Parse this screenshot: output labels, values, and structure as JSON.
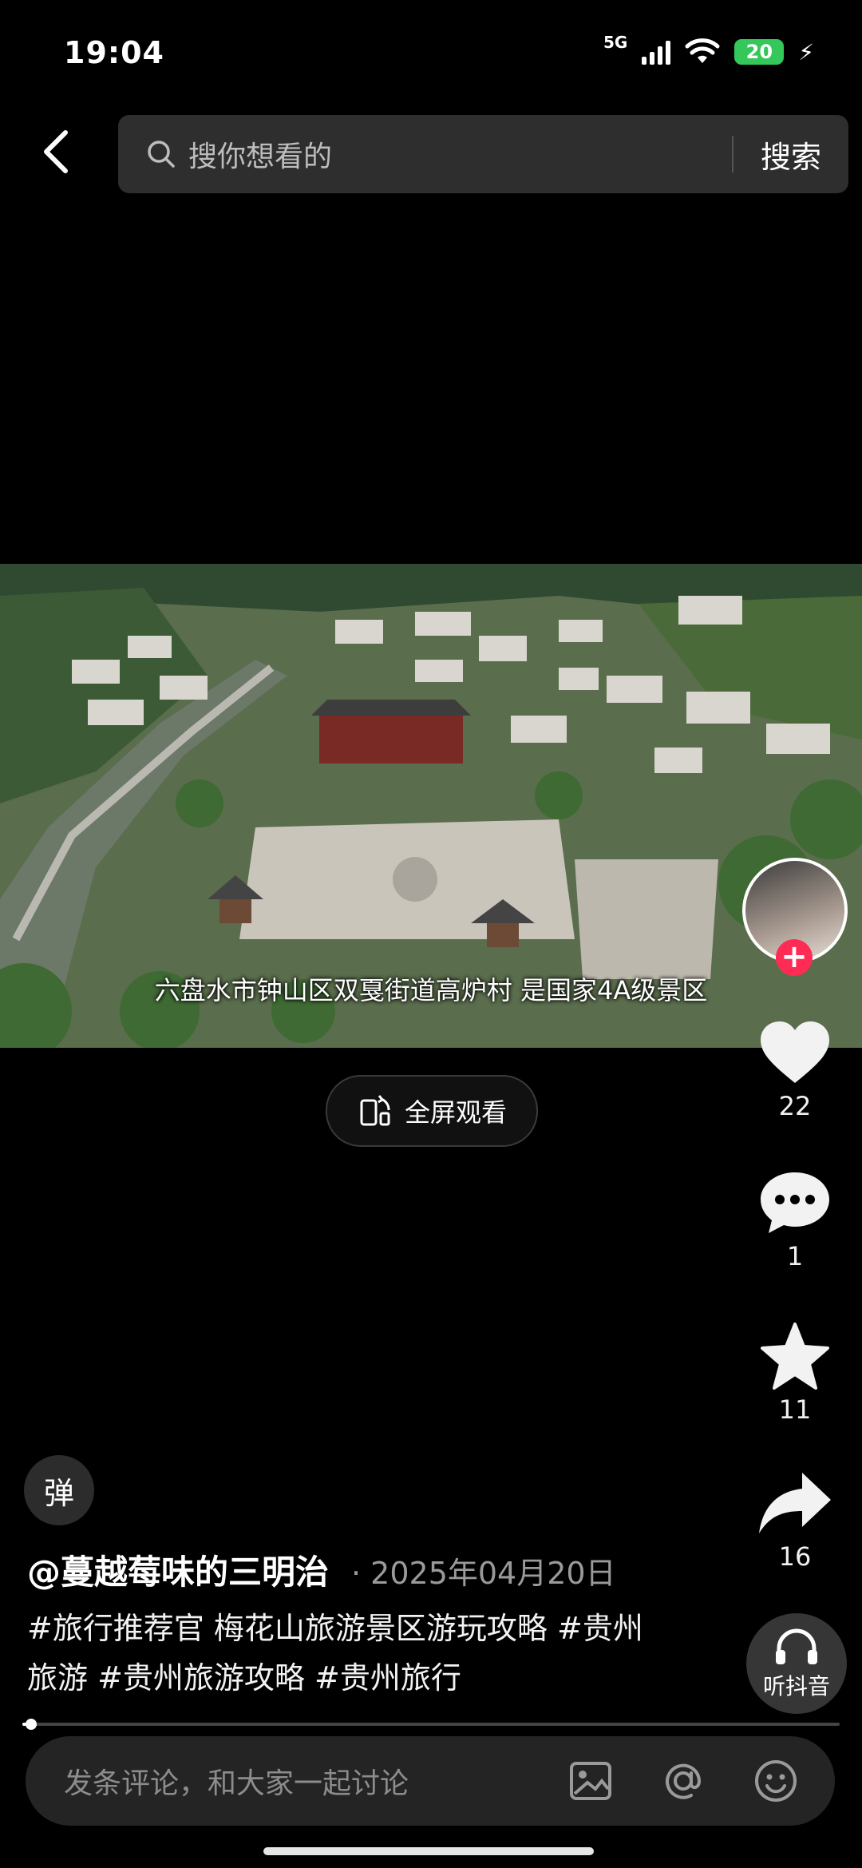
{
  "status": {
    "time": "19:04",
    "network": "5G",
    "battery": "20"
  },
  "search": {
    "placeholder": "搜你想看的",
    "button": "搜索"
  },
  "video": {
    "subtitle": "六盘水市钟山区双戛街道高炉村 是国家4A级景区",
    "fullscreen_label": "全屏观看",
    "progress": 0.006
  },
  "actions": {
    "likes": "22",
    "comments": "1",
    "favorites": "11",
    "shares": "16",
    "listen_label": "听抖音"
  },
  "danmaku": {
    "label": "弹"
  },
  "post": {
    "author": "@蔓越莓味的三明治",
    "date": "· 2025年04月20日",
    "description": "#旅行推荐官 梅花山旅游景区游玩攻略 #贵州旅游 #贵州旅游攻略 #贵州旅行"
  },
  "comment": {
    "placeholder": "发条评论，和大家一起讨论"
  },
  "icons": [
    "back-icon",
    "search-icon",
    "heart-icon",
    "comment-icon",
    "star-icon",
    "share-icon",
    "headphones-icon",
    "image-icon",
    "at-icon",
    "emoji-icon",
    "rotate-icon"
  ]
}
